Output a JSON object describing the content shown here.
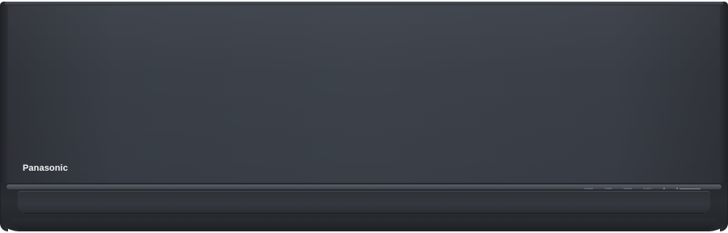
{
  "product": {
    "brand": "Panasonic",
    "indicators": [
      "POWER",
      "TIMER",
      "NANOE",
      "AI ECO",
      "",
      "nanoe X"
    ],
    "color_body": "#3a3f47",
    "color_louver": "#2a2d32",
    "color_logo": "#f2f3f5"
  }
}
